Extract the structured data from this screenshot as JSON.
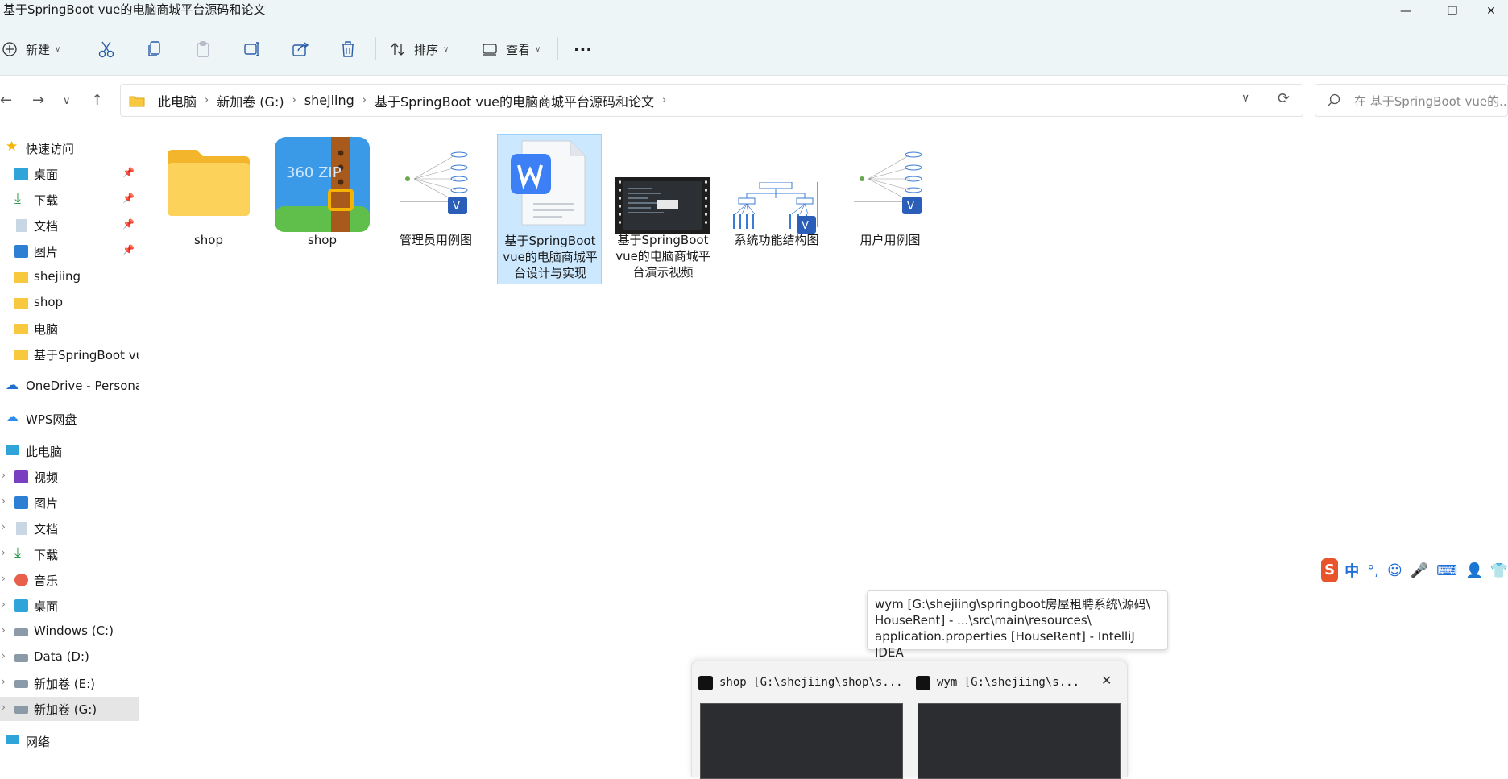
{
  "window": {
    "title": "基于SpringBoot vue的电脑商城平台源码和论文",
    "minimize": "—",
    "maximize": "❐",
    "close": "✕"
  },
  "toolbar": {
    "new_label": "新建",
    "sort_label": "排序",
    "view_label": "查看",
    "more_label": "···"
  },
  "nav": {
    "back": "←",
    "forward": "→",
    "recent": "∨",
    "up": "↑"
  },
  "address": {
    "crumbs": [
      "此电脑",
      "新加卷 (G:)",
      "shejiing",
      "基于SpringBoot vue的电脑商城平台源码和论文"
    ],
    "dropdown": "∨",
    "refresh": "⟳"
  },
  "search": {
    "placeholder": "在 基于SpringBoot vue的..."
  },
  "sidebar": {
    "quick_access": "快速访问",
    "pinned": [
      "桌面",
      "下载",
      "文档",
      "图片"
    ],
    "recent": [
      "shejiing",
      "shop",
      "电脑",
      "基于SpringBoot vue的电脑商城平台源码和论文"
    ],
    "onedrive": "OneDrive - Personal",
    "wps": "WPS网盘",
    "this_pc": "此电脑",
    "pc_items": [
      "视频",
      "图片",
      "文档",
      "下载",
      "音乐",
      "桌面",
      "Windows (C:)",
      "Data (D:)",
      "新加卷 (E:)",
      "新加卷 (G:)"
    ],
    "network": "网络"
  },
  "files": [
    {
      "name": "shop",
      "type": "folder"
    },
    {
      "name": "shop",
      "type": "zip",
      "badge": "360 ZIP"
    },
    {
      "name": "管理员用例图",
      "type": "visio"
    },
    {
      "name": "基于SpringBoot vue的电脑商城平台设计与实现",
      "type": "word",
      "selected": true
    },
    {
      "name": "基于SpringBoot vue的电脑商城平台演示视频",
      "type": "video"
    },
    {
      "name": "系统功能结构图",
      "type": "visio"
    },
    {
      "name": "用户用例图",
      "type": "visio"
    }
  ],
  "tooltip": {
    "line1": "wym [G:\\shejiing\\springboot房屋租聘系统\\源码\\",
    "line2": "HouseRent] - ...\\src\\main\\resources\\",
    "line3": "application.properties [HouseRent] - IntelliJ IDEA"
  },
  "taskbar_preview": [
    {
      "title": "shop [G:\\shejiing\\shop\\s..."
    },
    {
      "title": "wym [G:\\shejiing\\s..."
    }
  ],
  "ime": {
    "zh": "中",
    "punct": "°,"
  },
  "colors": {
    "accent": "#0067c0",
    "selected_bg": "#cce8ff",
    "toolbar_bg": "#eef5f7",
    "folder": "#f8c83e"
  }
}
